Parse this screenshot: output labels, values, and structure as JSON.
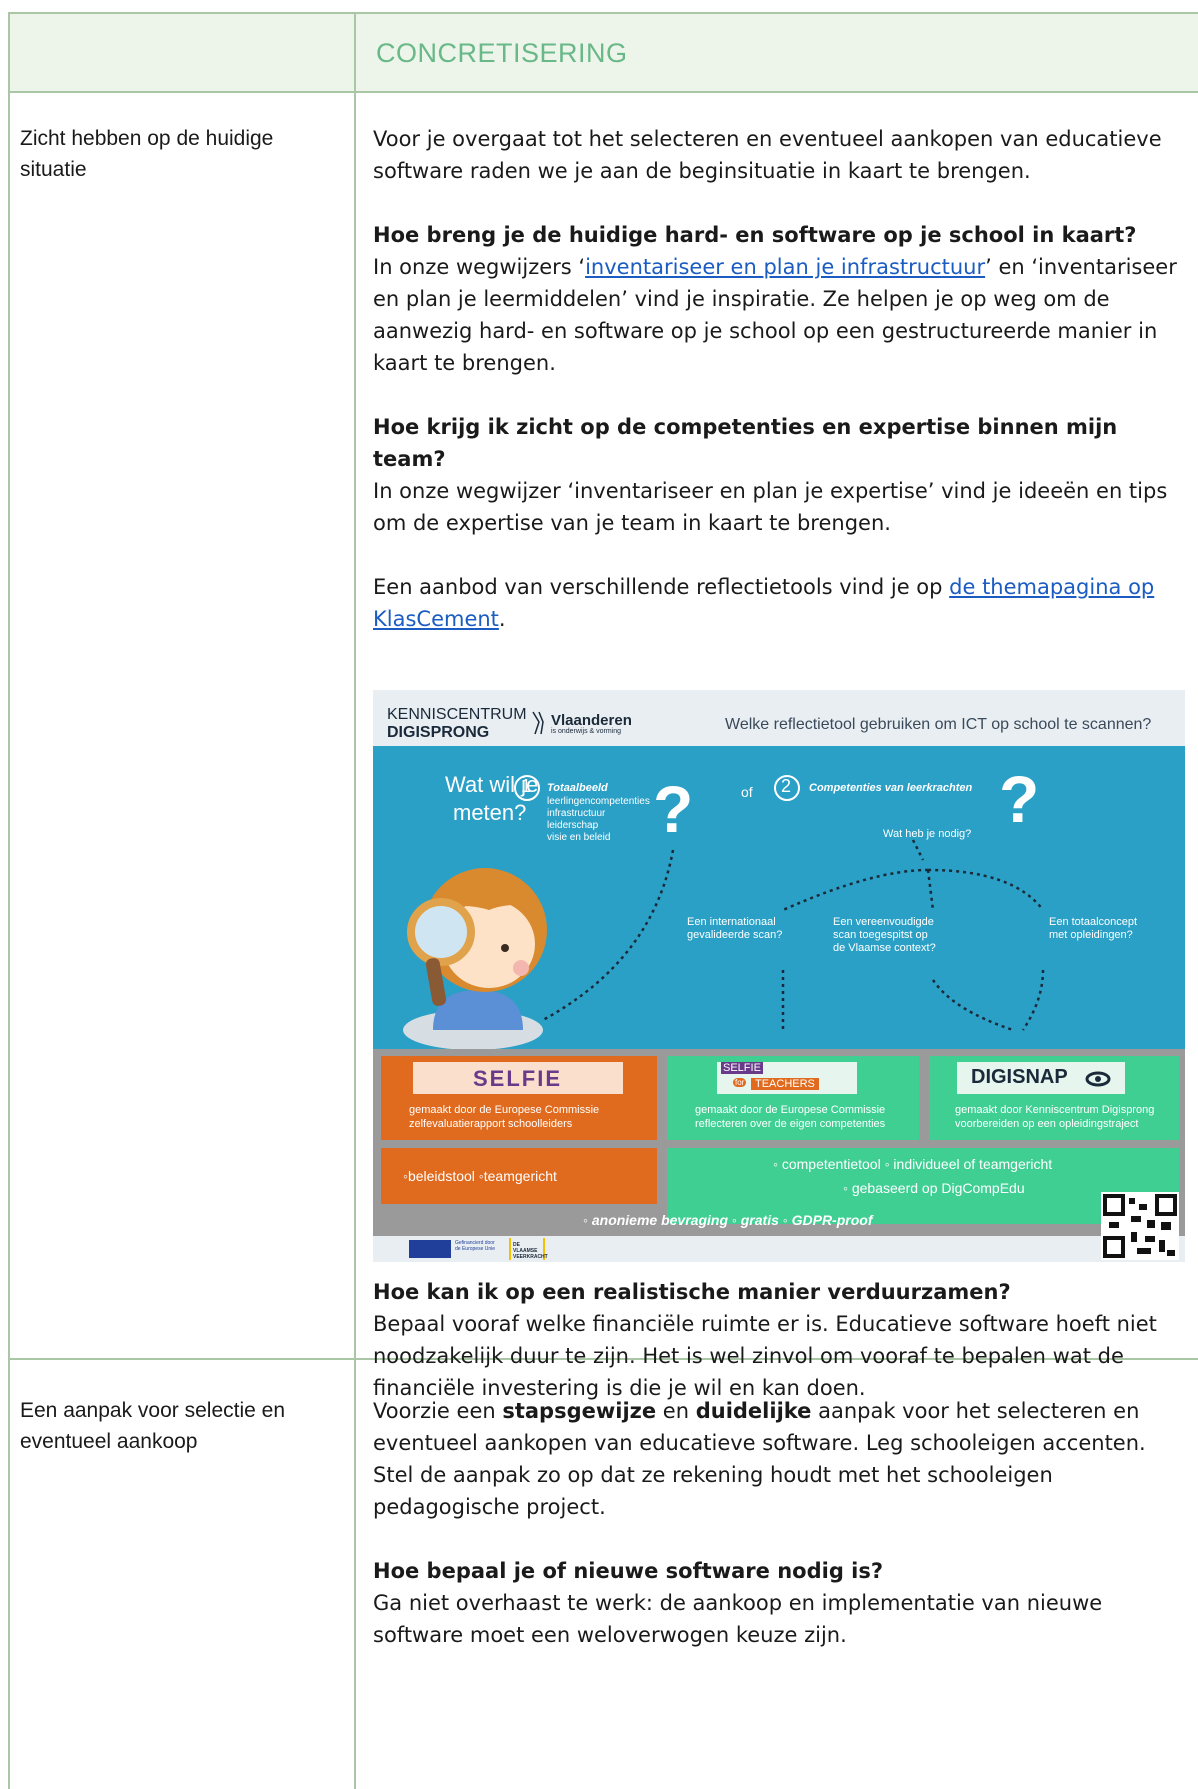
{
  "header": {
    "title": "CONCRETISERING"
  },
  "rows": [
    {
      "label": "Zicht hebben op de huidige situatie",
      "intro": "Voor je overgaat tot het selecteren en eventueel aankopen van educatieve software raden we je aan de beginsituatie in kaart te brengen.",
      "q1": "Hoe breng je de huidige hard- en software op je school in kaart?",
      "q1_text_a": "In onze wegwijzers ‘",
      "q1_link": "inventariseer en plan je infrastructuur",
      "q1_text_b": "’ en ‘inventariseer en plan je leermiddelen’ vind je inspiratie. Ze helpen je op weg om de aanwezig hard- en software op je school op een gestructureerde manier in kaart te brengen.",
      "q2": "Hoe krijg ik zicht op de competenties en expertise binnen mijn team?",
      "q2_text": "In onze wegwijzer ‘inventariseer en plan je expertise’ vind je ideeën en tips om de expertise van je team in kaart te brengen.",
      "tools_text": "Een aanbod van verschillende reflectietools vind je op ",
      "tools_link": "de themapagina op KlasCement",
      "tools_end": ".",
      "q3": "Hoe kan ik op een realistische manier verduurzamen?",
      "q3_text": "Bepaal vooraf welke financiële ruimte er is. Educatieve software hoeft niet noodzakelijk duur te zijn. Het is wel zinvol om vooraf te bepalen wat de financiële investering is die je wil en kan doen."
    },
    {
      "label": "Een aanpak voor selectie en eventueel aankoop",
      "p1_a": "Voorzie een ",
      "p1_b1": "stapsgewijze",
      "p1_mid": " en ",
      "p1_b2": "duidelijke",
      "p1_c": " aanpak voor het selecteren en eventueel aankopen van educatieve software. Leg schooleigen accenten. Stel de aanpak zo op dat ze rekening houdt met het schooleigen pedagogische project.",
      "q4": "Hoe bepaal je of nieuwe software nodig is?",
      "q4_text": "Ga niet overhaast te werk: de aankoop en implementatie van nieuwe software moet een weloverwogen keuze zijn."
    }
  ],
  "infographic": {
    "brand1": "KENNISCENTRUM",
    "brand2": "DIGISPRONG",
    "vl_name": "Vlaanderen",
    "vl_sub": "is onderwijs & vorming",
    "question": "Welke reflectietool gebruiken om ICT op school te scannen?",
    "ask1": "Wat wil je",
    "ask2": "meten?",
    "opt1_num": "1",
    "opt1_title": "Totaalbeeld",
    "opt1_items": [
      "leerlingencompetenties",
      "infrastructuur",
      "leiderschap",
      "visie en beleid"
    ],
    "of": "of",
    "opt2_num": "2",
    "opt2_title": "Competenties van leerkrachten",
    "need": "Wat heb je nodig?",
    "need_a": [
      "Een internationaal",
      "gevalideerde scan?"
    ],
    "need_b": [
      "Een vereenvoudigde",
      "scan toegespitst op",
      "de Vlaamse context?"
    ],
    "need_c": [
      "Een totaalconcept",
      "met opleidingen?"
    ],
    "tool1": "SELFIE",
    "tool2a": "SELFIE",
    "tool2b": "for",
    "tool2c": "TEACHERS",
    "tool3": "DIGISNAP",
    "t1_lines": [
      "gemaakt door de Europese Commissie",
      "zelfevaluatierapport schoolleiders"
    ],
    "t2_lines": [
      "gemaakt door de Europese Commissie",
      "reflecteren over de eigen competenties"
    ],
    "t3_lines": [
      "gemaakt door Kenniscentrum Digisprong",
      "voorbereiden op een opleidingstraject"
    ],
    "t1_feat": "◦beleidstool   ◦teamgericht",
    "t23_feat1": "◦ competentietool  ◦ individueel of teamgericht",
    "t23_feat2": "◦ gebaseerd op DigCompEdu",
    "common": "◦ anonieme bevraging   ◦ gratis   ◦ GDPR-proof",
    "eu_text": "Gefinancierd door de Europese Unie",
    "vk_text": "DE VLAAMSE VEERKRACHT",
    "colors": {
      "blue": "#2aa0c6",
      "orange": "#e06a1e",
      "green": "#3fcf93",
      "grey": "#9a9a9a"
    }
  }
}
